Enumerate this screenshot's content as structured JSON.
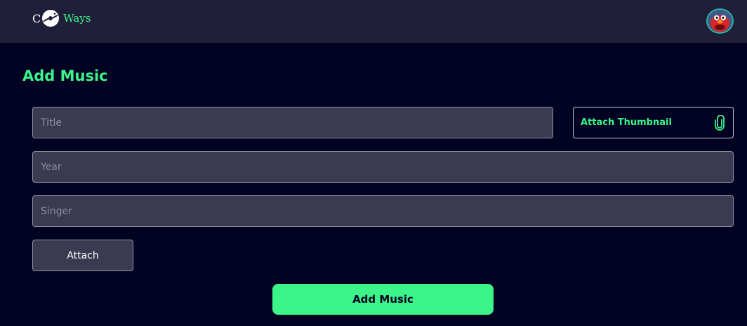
{
  "brand": {
    "letter": "C",
    "name": "Ways"
  },
  "navbar": {
    "avatar_icon": "user-avatar-icon"
  },
  "page": {
    "title": "Add Music"
  },
  "form": {
    "title_placeholder": "Title",
    "year_placeholder": "Year",
    "singer_placeholder": "Singer",
    "thumbnail_label": "Attach Thumbnail",
    "thumbnail_icon": "paperclip-icon",
    "attach_label": "Attach",
    "submit_label": "Add Music"
  },
  "colors": {
    "background": "#020222",
    "navbar": "#1f1f3a",
    "accent": "#3bf48a",
    "field": "#3a3a51"
  }
}
